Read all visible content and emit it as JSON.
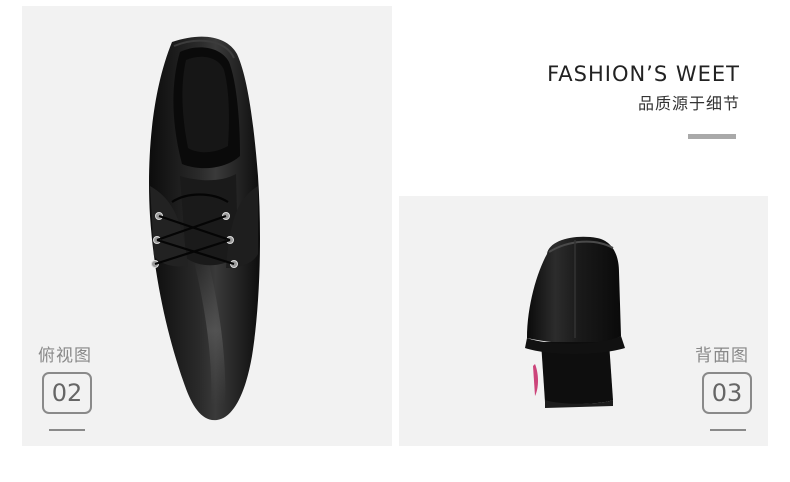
{
  "headline": {
    "title_en": "FASHION’S WEET",
    "subtitle_cn": "品质源于细节"
  },
  "views": [
    {
      "label": "俯视图",
      "number": "02"
    },
    {
      "label": "背面图",
      "number": "03"
    }
  ],
  "colors": {
    "panel_bg": "#f2f2f2",
    "accent_gray": "#8a8a8a",
    "bar_gray": "#a9a9a9",
    "text_dark": "#222222"
  }
}
